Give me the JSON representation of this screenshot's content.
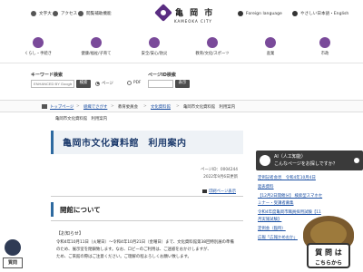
{
  "header": {
    "util_links": [
      "文字大",
      "アクセス",
      "閲覧補助機能"
    ],
    "logo_jp": "亀 岡 市",
    "logo_en": "KAMEOKA CITY",
    "foreign": "Foreign language",
    "easy_jp": "やさしい日本語・English"
  },
  "categories": [
    "くらし・手続き",
    "健康/福祉/子育て",
    "安全/安心/防災",
    "教育/文化/スポーツ",
    "産業",
    "市政"
  ],
  "search": {
    "keyword_title": "キーワード検索",
    "keyword_placeholder": "ENHANCED BY Google",
    "keyword_button": "検索",
    "page_id_title": "ページID検索",
    "page_id_button": "表示",
    "radio_page": "ページ",
    "radio_pdf": "PDF"
  },
  "breadcrumb": {
    "items": [
      "トップページ",
      "組織でさがす",
      "教育委員会",
      "文化資料館",
      "亀岡市文化資料館　利用案内"
    ]
  },
  "subcrumb": "亀岡市文化資料館　利用案内",
  "page": {
    "title": "亀岡市文化資料館　利用案内",
    "page_id": "ページID：0004244",
    "updated": "2022年9月6日更新",
    "print": "印刷ページ表示",
    "section_title": "開館について",
    "notice_heading": "【お知らせ】",
    "paragraphs": [
      "令和4年10月11日（火曜日）～令和4年10月21日（金曜日）まで、文化資料館第38回特別展の準備",
      "のため、展示室を閉鎖致します。なお、ロビーのご利用は、ご迷惑をおかけしますが、",
      "ため、ご来館の際はご注意ください。ご理解の程よろしくお願い致します。"
    ]
  },
  "sidebar": {
    "ai_line1": "AI（人工知能）",
    "ai_line2": "こんなページをお探しですか？",
    "news": [
      {
        "date": "定例記者会見　令和4年10月4日",
        "type": "link"
      },
      {
        "date": "発表資料",
        "type": "link"
      },
      {
        "date": "【12月2日開催分】 検索型スマホセ",
        "type": "link"
      },
      {
        "date": "ミナー・受講者募集",
        "type": "link"
      },
      {
        "date": "令和4年度亀岡市職員採用試験【11",
        "type": "link"
      },
      {
        "date": "月実施試験】",
        "type": "link"
      },
      {
        "date": "定例会（臨時）",
        "type": "link"
      },
      {
        "date": "広報「広報かめおか」",
        "type": "link"
      }
    ]
  },
  "mascot": {
    "sign_line1": "質 問 は",
    "sign_line2": "こちらから",
    "left_badge": "質問"
  }
}
